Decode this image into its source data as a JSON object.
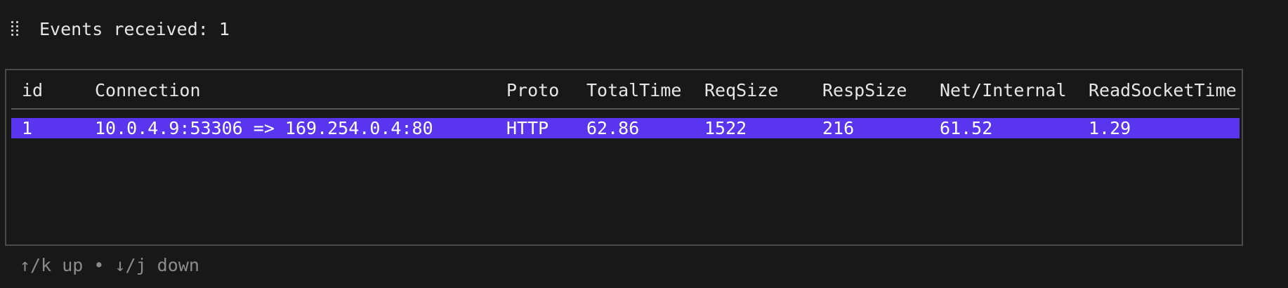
{
  "header": {
    "events_label": "Events received: 1"
  },
  "table": {
    "columns": [
      "id",
      "Connection",
      "Proto",
      "TotalTime",
      "ReqSize",
      "RespSize",
      "Net/Internal",
      "ReadSocketTime"
    ],
    "rows": [
      [
        "1",
        "10.0.4.9:53306 => 169.254.0.4:80",
        "HTTP",
        "62.86",
        "1522",
        "216",
        "61.52",
        "1.29"
      ]
    ],
    "selected_row": 0
  },
  "footer": {
    "help": "↑/k up • ↓/j down"
  },
  "colors": {
    "background": "#181818",
    "selected_row": "#5a35f0",
    "border": "#4a4a4a",
    "help_text": "#8c8c8c"
  }
}
